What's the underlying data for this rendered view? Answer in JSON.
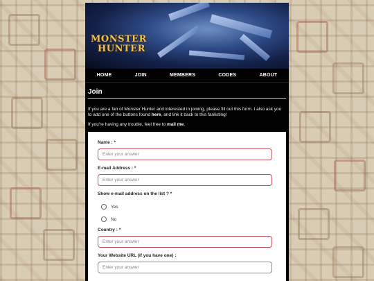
{
  "nav": {
    "items": [
      "HOME",
      "JOIN",
      "MEMBERS",
      "CODES",
      "ABOUT"
    ]
  },
  "logo": {
    "line1": "MONSTER",
    "line2": "HUNTER"
  },
  "page": {
    "title": "Join",
    "intro_1_a": "If you are a fan of Monster Hunter and interested in joining, please fill out this form. I also ask you to add one of the buttons found ",
    "intro_1_link": "here",
    "intro_1_b": ", and link it back to this fanlisting!",
    "intro_2_a": "If you're having any trouble, feel free to ",
    "intro_2_link": "mail me",
    "intro_2_b": "."
  },
  "form": {
    "name_label": "Name : *",
    "email_label": "E-mail Address : *",
    "show_email_label": "Show e-mail address on the list ? *",
    "yes_label": "Yes",
    "no_label": "No",
    "country_label": "Country : *",
    "website_label": "Your Website URL (if you have one) :",
    "placeholder": "Enter your answer"
  },
  "colors": {
    "required_border": "#c5525a",
    "page_bg": "#d8ccb4",
    "frame_bg": "#000000"
  }
}
